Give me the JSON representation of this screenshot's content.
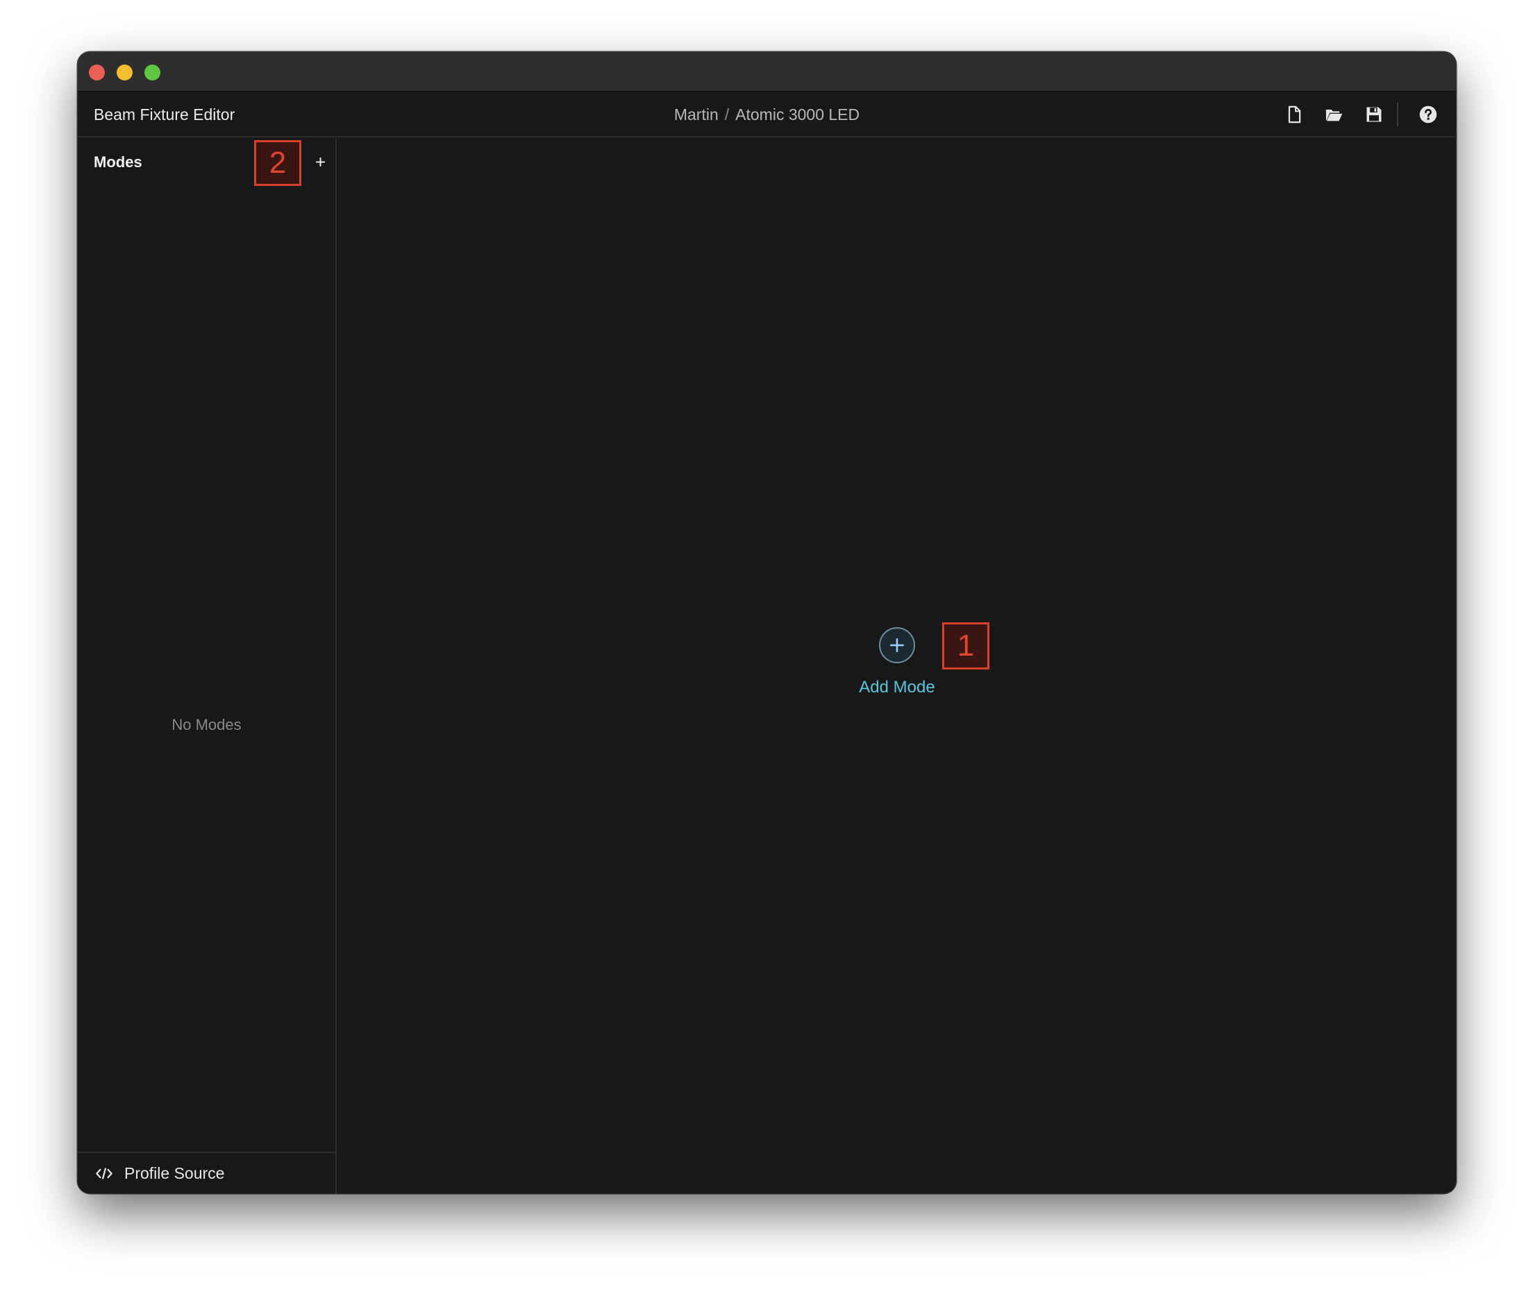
{
  "window": {
    "controls": [
      "close",
      "minimize",
      "zoom"
    ]
  },
  "header": {
    "app_title": "Beam Fixture Editor",
    "breadcrumb": {
      "manufacturer": "Martin",
      "separator": "/",
      "fixture": "Atomic 3000 LED"
    },
    "toolbar": [
      {
        "name": "new-file-icon"
      },
      {
        "name": "open-folder-icon"
      },
      {
        "name": "save-icon"
      },
      {
        "name": "help-icon"
      }
    ]
  },
  "sidebar": {
    "title": "Modes",
    "empty_text": "No Modes",
    "footer_label": "Profile Source"
  },
  "main": {
    "add_mode_label": "Add Mode"
  },
  "annotations": {
    "marker_1": "1",
    "marker_2": "2"
  },
  "colors": {
    "accent": "#56c7dc",
    "marker": "#d9402c",
    "background": "#181818"
  }
}
